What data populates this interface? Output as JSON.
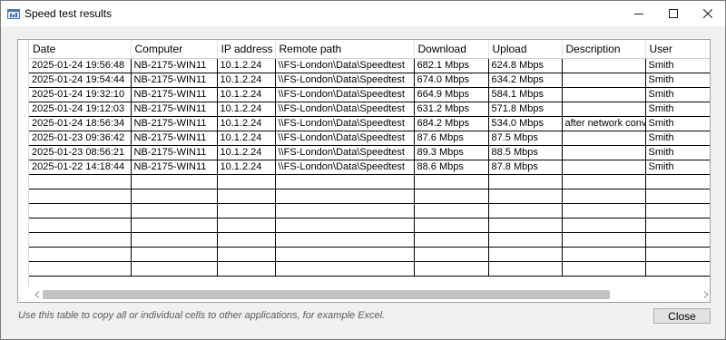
{
  "window": {
    "title": "Speed test results",
    "icon": "speed-test-app-icon",
    "controls": [
      "minimize-icon",
      "maximize-icon",
      "close-icon"
    ]
  },
  "table": {
    "headers": [
      "Date",
      "Computer",
      "IP address",
      "Remote path",
      "Download",
      "Upload",
      "Description",
      "User"
    ],
    "rows": [
      [
        "2025-01-24 19:56:48",
        "NB-2175-WIN11",
        "10.1.2.24",
        "\\\\FS-London\\Data\\Speedtest",
        "682.1 Mbps",
        "624.8 Mbps",
        "",
        "Smith"
      ],
      [
        "2025-01-24 19:54:44",
        "NB-2175-WIN11",
        "10.1.2.24",
        "\\\\FS-London\\Data\\Speedtest",
        "674.0 Mbps",
        "634.2 Mbps",
        "",
        "Smith"
      ],
      [
        "2025-01-24 19:32:10",
        "NB-2175-WIN11",
        "10.1.2.24",
        "\\\\FS-London\\Data\\Speedtest",
        "664.9 Mbps",
        "584.1 Mbps",
        "",
        "Smith"
      ],
      [
        "2025-01-24 19:12:03",
        "NB-2175-WIN11",
        "10.1.2.24",
        "\\\\FS-London\\Data\\Speedtest",
        "631.2 Mbps",
        "571.8 Mbps",
        "",
        "Smith"
      ],
      [
        "2025-01-24 18:56:34",
        "NB-2175-WIN11",
        "10.1.2.24",
        "\\\\FS-London\\Data\\Speedtest",
        "684.2 Mbps",
        "534.0 Mbps",
        "after network conve",
        "Smith"
      ],
      [
        "2025-01-23 09:36:42",
        "NB-2175-WIN11",
        "10.1.2.24",
        "\\\\FS-London\\Data\\Speedtest",
        " 87.6 Mbps",
        " 87.5 Mbps",
        "",
        "Smith"
      ],
      [
        "2025-01-23 08:56:21",
        "NB-2175-WIN11",
        "10.1.2.24",
        "\\\\FS-London\\Data\\Speedtest",
        " 89.3 Mbps",
        " 88.5 Mbps",
        "",
        "Smith"
      ],
      [
        "2025-01-22 14:18:44",
        "NB-2175-WIN11",
        "10.1.2.24",
        "\\\\FS-London\\Data\\Speedtest",
        " 88.6 Mbps",
        " 87.8 Mbps",
        "",
        "Smith"
      ]
    ]
  },
  "scrollbar": {
    "left_icon": "chevron-left-icon",
    "right_icon": "chevron-right-icon"
  },
  "footer": {
    "hint": "Use this table to copy all or individual cells to other applications, for example Excel.",
    "close_label": "Close"
  }
}
